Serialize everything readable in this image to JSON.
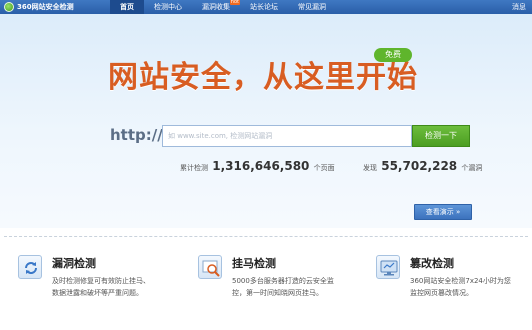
{
  "nav": {
    "logo": "360网站安全检测",
    "items": [
      "首页",
      "检测中心",
      "漏洞收集",
      "站长论坛",
      "常见漏洞"
    ],
    "hot_badge": "hot",
    "right_link": "消息"
  },
  "hero": {
    "slogan": "网站安全，从这里开始",
    "free_badge": "免费",
    "http_label": "http://",
    "search_placeholder": "如 www.site.com, 检测网站漏洞",
    "search_button": "检测一下",
    "stat_left_prefix": "累计检测",
    "stat_left_value": "1,316,646,580",
    "stat_left_suffix": "个页面",
    "stat_right_prefix": "发现",
    "stat_right_value": "55,702,228",
    "stat_right_suffix": "个漏洞",
    "demo_button": "查看演示 »"
  },
  "features": [
    {
      "title": "漏洞检测",
      "desc1": "及时检测修复可有效防止挂马、",
      "desc2": "数据泄露和破坏等严重问题。",
      "icon": "refresh-icon"
    },
    {
      "title": "挂马检测",
      "desc1": "5000多台服务器打造的云安全监",
      "desc2": "控，第一时间知晓网页挂马。",
      "icon": "magnifier-icon"
    },
    {
      "title": "篡改检测",
      "desc1": "360网站安全检测7x24小时为您",
      "desc2": "监控网页篡改情况。",
      "icon": "monitor-icon"
    }
  ],
  "colors": {
    "nav_bg": "#2a5ea8",
    "slogan": "#d85d22",
    "search_button": "#4c9e22",
    "demo_button": "#3c72bd"
  }
}
